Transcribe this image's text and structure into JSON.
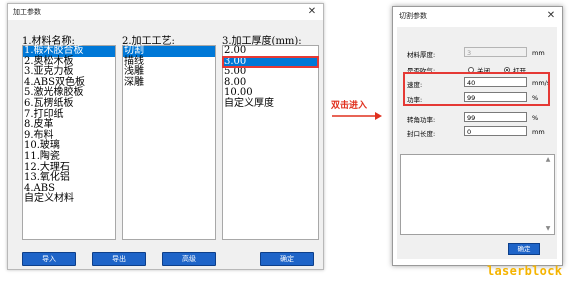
{
  "dialog1": {
    "title": "加工参数",
    "close": "✕",
    "columns": {
      "material": {
        "header": "1.材料名称:",
        "items": [
          "1.椴木胶合板",
          "2.奥松木板",
          "3.亚克力板",
          "4.ABS双色板",
          "5.激光橡胶板",
          "6.瓦楞纸板",
          "7.打印纸",
          "8.皮革",
          "9.布料",
          "10.玻璃",
          "11.陶瓷",
          "12.大理石",
          "13.氧化铝",
          "4.ABS",
          "自定义材料"
        ],
        "selected_index": 0
      },
      "process": {
        "header": "2.加工工艺:",
        "items": [
          "切割",
          "描线",
          "浅雕",
          "深雕"
        ],
        "selected_index": 0
      },
      "thickness": {
        "header": "3.加工厚度(mm):",
        "items": [
          "2.00",
          "3.00",
          "5.00",
          "8.00",
          "10.00",
          "自定义厚度"
        ],
        "selected_index": 1
      }
    },
    "buttons": {
      "import": "导入",
      "export": "导出",
      "advanced": "高级",
      "confirm": "确定"
    }
  },
  "annotation": {
    "label": "双击进入",
    "color": "#e0301e"
  },
  "dialog2": {
    "title": "切割参数",
    "close": "✕",
    "fields": {
      "thickness": {
        "label": "材料厚度:",
        "value": "3",
        "unit": "mm"
      },
      "air": {
        "label": "是否吹气:",
        "off": "关闭",
        "on": "打开",
        "selected": "on"
      },
      "speed": {
        "label": "速度:",
        "value": "40",
        "unit": "mm/s"
      },
      "power": {
        "label": "功率:",
        "value": "99",
        "unit": "%"
      },
      "corner_power": {
        "label": "转角功率:",
        "value": "99",
        "unit": "%"
      },
      "seal_length": {
        "label": "封口长度:",
        "value": "0",
        "unit": "mm"
      }
    },
    "confirm": "确定"
  },
  "brand": "laserblock",
  "colors": {
    "selection": "#0078d7",
    "button_blue": "#1e64c8",
    "highlight_red": "#e53935",
    "brand_yellow": "#f5b400"
  }
}
